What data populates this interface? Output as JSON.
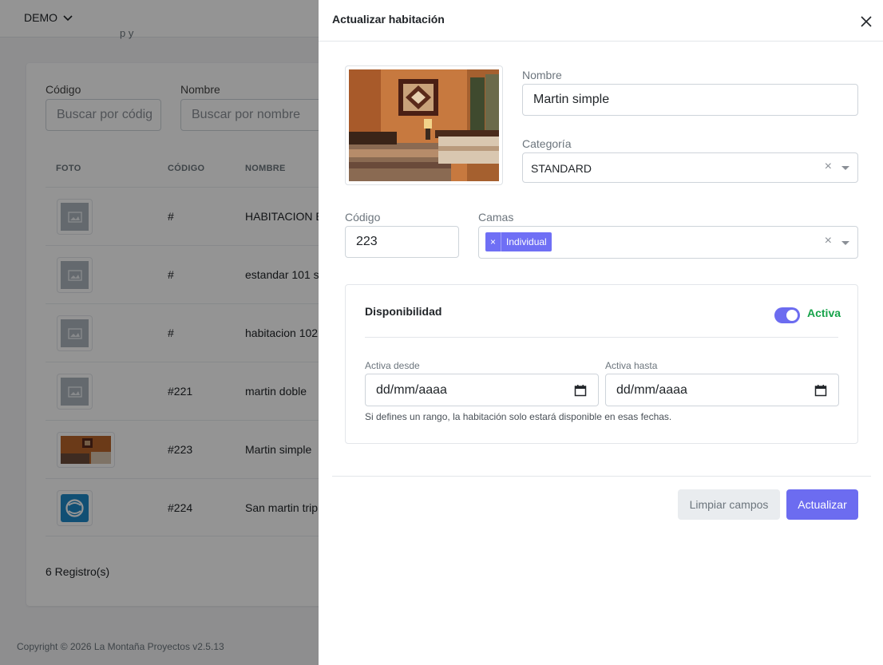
{
  "header": {
    "brand": "DEMO"
  },
  "background": {
    "subtitle_fragment": "p                y",
    "filters": [
      {
        "label": "Código",
        "placeholder": "Buscar por códig"
      },
      {
        "label": "Nombre",
        "placeholder": "Buscar por nombre"
      }
    ],
    "columns": [
      "FOTO",
      "CÓDIGO",
      "NOMBRE"
    ],
    "rows": [
      {
        "code": "#",
        "name": "HABITACION E"
      },
      {
        "code": "#",
        "name": "estandar 101 s"
      },
      {
        "code": "#",
        "name": "habitacion 102"
      },
      {
        "code": "#221",
        "name": "martin doble"
      },
      {
        "code": "#223",
        "name": "Martin simple"
      },
      {
        "code": "#224",
        "name": "San martin trip"
      }
    ],
    "records": "6 Registro(s)",
    "footer": "Copyright © 2026 La Montaña Proyectos v2.5.13"
  },
  "drawer": {
    "title": "Actualizar habitación",
    "nombre": {
      "label": "Nombre",
      "value": "Martin simple"
    },
    "categoria": {
      "label": "Categoría",
      "value": "STANDARD",
      "clear": "×"
    },
    "codigo": {
      "label": "Código",
      "value": "223"
    },
    "camas": {
      "label": "Camas",
      "tags": [
        "Individual"
      ],
      "tag_remove": "×",
      "clear": "×"
    },
    "disponibilidad": {
      "title": "Disponibilidad",
      "toggle_label": "Activa",
      "toggle_on": true,
      "desde_label": "Activa desde",
      "desde_value": "dd/mm/aaaa",
      "hasta_label": "Activa hasta",
      "hasta_value": "dd/mm/aaaa",
      "help": "Si defines un rango, la habitación solo estará disponible en esas fechas."
    },
    "buttons": {
      "clear": "Limpiar campos",
      "update": "Actualizar"
    }
  },
  "colors": {
    "primary": "#6c6cf0",
    "active_green": "#16a34a",
    "overlay": "rgba(0,0,0,0.42)"
  },
  "icons": [
    "chevron-down-icon",
    "image-placeholder-icon",
    "close-icon",
    "calendar-icon",
    "logo-s-icon"
  ]
}
